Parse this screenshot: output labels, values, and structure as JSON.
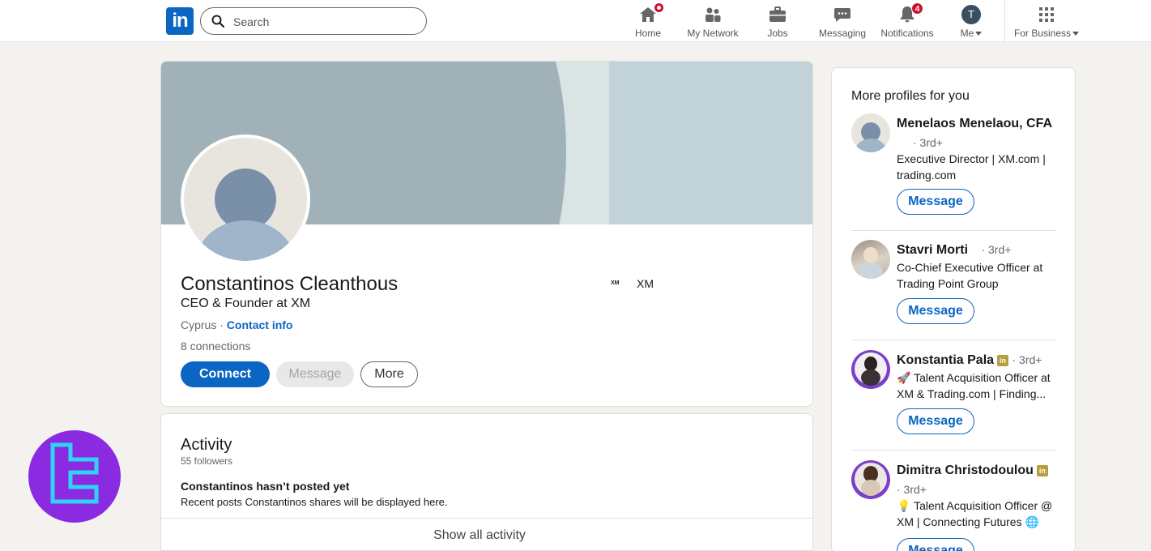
{
  "nav": {
    "search_placeholder": "Search",
    "items": [
      {
        "label": "Home",
        "icon": "home-icon"
      },
      {
        "label": "My Network",
        "icon": "my-network-icon"
      },
      {
        "label": "Jobs",
        "icon": "jobs-icon"
      },
      {
        "label": "Messaging",
        "icon": "messaging-icon"
      },
      {
        "label": "Notifications",
        "icon": "notifications-icon",
        "badge": "4"
      },
      {
        "label": "Me",
        "icon": "avatar",
        "initial": "T"
      },
      {
        "label": "For Business",
        "icon": "grid-icon"
      }
    ],
    "logo": "in"
  },
  "profile": {
    "name": "Constantinos Cleanthous",
    "headline": "CEO & Founder at XM",
    "location": "Cyprus",
    "contact_info": "Contact info",
    "connections": "8 connections",
    "company_logo_text": "XM",
    "company": "XM",
    "buttons": {
      "connect": "Connect",
      "message": "Message",
      "more": "More"
    }
  },
  "activity": {
    "title": "Activity",
    "followers": "55 followers",
    "empty_title": "Constantinos hasn’t posted yet",
    "empty_sub": "Recent posts Constantinos shares will be displayed here.",
    "show_all": "Show all activity"
  },
  "sidebar": {
    "title": "More profiles for you",
    "profiles": [
      {
        "name": "Menelaos Menelaou, CFA",
        "degree": "· 3rd+",
        "desc": "Executive Director | XM.com | trading.com",
        "button": "Message"
      },
      {
        "name": "Stavri Morti",
        "degree": "· 3rd+",
        "desc": "Co-Chief Executive Officer at Trading Point Group",
        "button": "Message"
      },
      {
        "name": "Konstantia Pala",
        "degree": "· 3rd+",
        "desc": "🚀 Talent Acquisition Officer at XM & Trading.com | Finding...",
        "button": "Message"
      },
      {
        "name": "Dimitra Christodoulou",
        "degree": "· 3rd+",
        "desc": "💡 Talent Acquisition Officer @ XM | Connecting Futures 🌐",
        "button": "Message"
      }
    ]
  },
  "colors": {
    "brand": "#0a66c2",
    "badge": "#cb112d",
    "watermark": "#8a2be2"
  }
}
